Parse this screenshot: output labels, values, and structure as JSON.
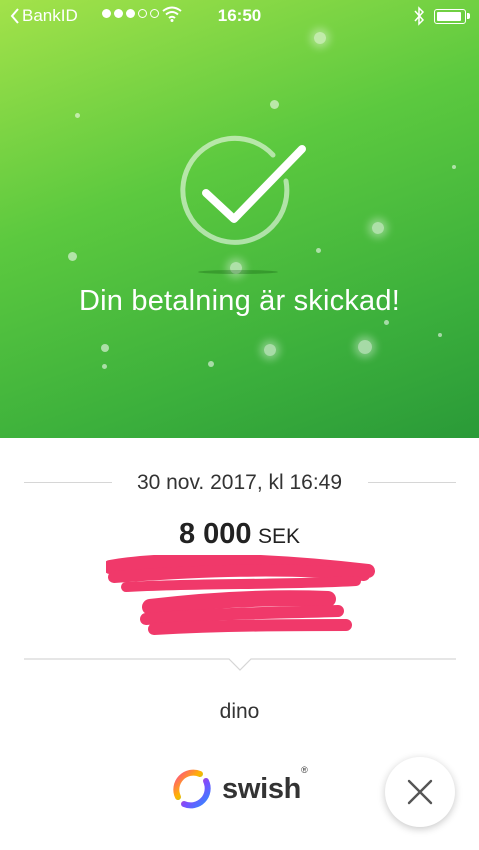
{
  "status_bar": {
    "back_app": "BankID",
    "time": "16:50",
    "icons": [
      "back-chevron-icon",
      "signal-dots-icon",
      "wifi-icon",
      "bluetooth-icon",
      "battery-icon"
    ]
  },
  "confirmation": {
    "headline": "Din betalning är skickad!",
    "icon": "checkmark-circle-icon"
  },
  "details": {
    "date": "30 nov. 2017, kl 16:49",
    "amount": "8 000",
    "currency": "SEK",
    "message": "dino"
  },
  "footer": {
    "brand": "swish",
    "brand_mark": "®",
    "close_icon": "close-icon"
  },
  "colors": {
    "hero_start": "#a3e24a",
    "hero_end": "#2a9a38",
    "redaction": "#f0396a"
  }
}
